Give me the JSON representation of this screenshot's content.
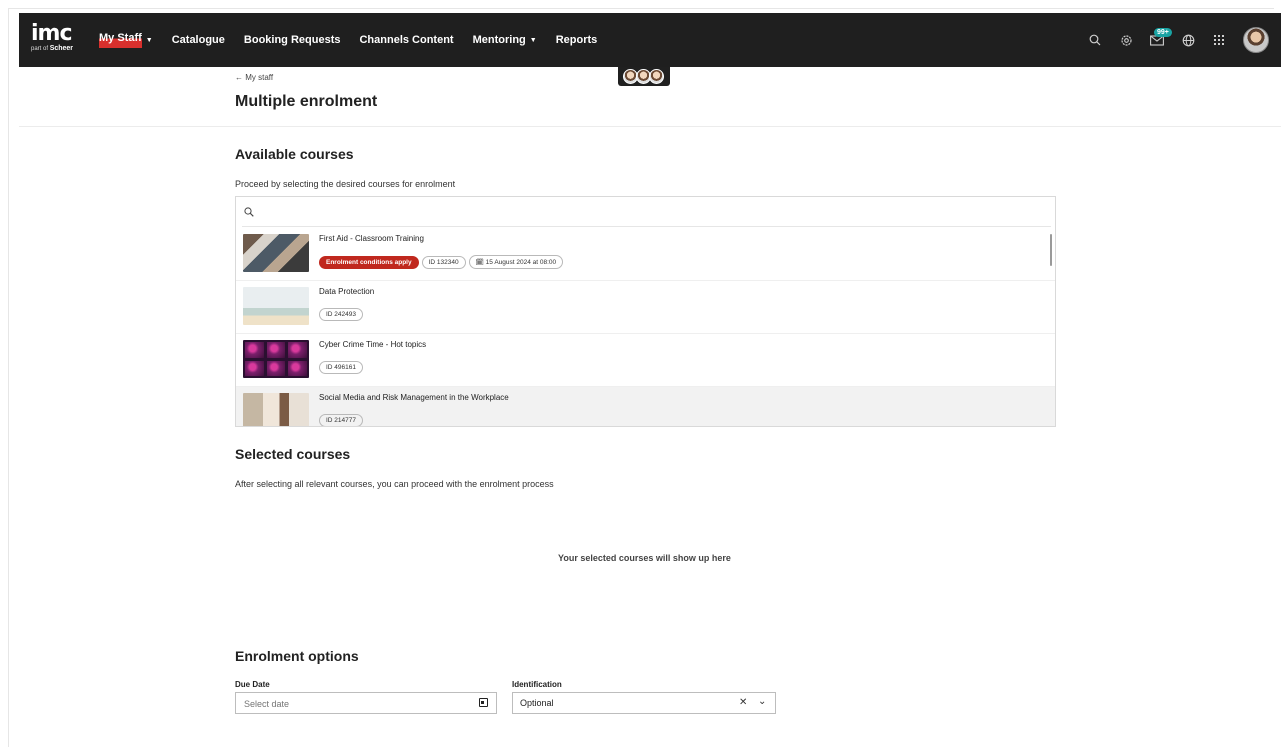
{
  "brand": {
    "name": "imc",
    "tagline_prefix": "part of",
    "tagline_brand": "Scheer"
  },
  "nav": {
    "items": [
      {
        "label": "My Staff",
        "dropdown": true,
        "active": true
      },
      {
        "label": "Catalogue",
        "dropdown": false
      },
      {
        "label": "Booking Requests",
        "dropdown": false
      },
      {
        "label": "Channels Content",
        "dropdown": false
      },
      {
        "label": "Mentoring",
        "dropdown": true
      },
      {
        "label": "Reports",
        "dropdown": false
      }
    ],
    "icons": [
      "search-icon",
      "settings-icon",
      "messages-icon",
      "globe-icon",
      "apps-grid-icon"
    ],
    "messages_badge": "99+",
    "colors": {
      "bar": "#1f1f1f",
      "active_underline": "#d8302d",
      "badge": "#1aa3a3"
    }
  },
  "header": {
    "breadcrumb": "← My staff",
    "title": "Multiple enrolment"
  },
  "available": {
    "title": "Available courses",
    "subtitle": "Proceed by selecting the desired courses for enrolment",
    "search_placeholder": "",
    "courses": [
      {
        "title": "First Aid - Classroom Training",
        "warning": "Enrolment conditions apply",
        "id": "ID 132340",
        "date": "🗓 15 August 2024 at 08:00"
      },
      {
        "title": "Data Protection",
        "id": "ID 242493"
      },
      {
        "title": "Cyber Crime Time - Hot topics",
        "id": "ID 496161"
      },
      {
        "title": "Social Media and Risk Management in the Workplace",
        "id": "ID 214777"
      }
    ],
    "warning_color": "#c0281e"
  },
  "selected": {
    "title": "Selected courses",
    "subtitle": "After selecting all relevant courses, you can proceed with the enrolment process",
    "empty_message": "Your selected courses will show up here"
  },
  "options": {
    "title": "Enrolment options",
    "due_date_label": "Due Date",
    "due_date_placeholder": "Select date",
    "identification_label": "Identification",
    "identification_value": "Optional"
  }
}
